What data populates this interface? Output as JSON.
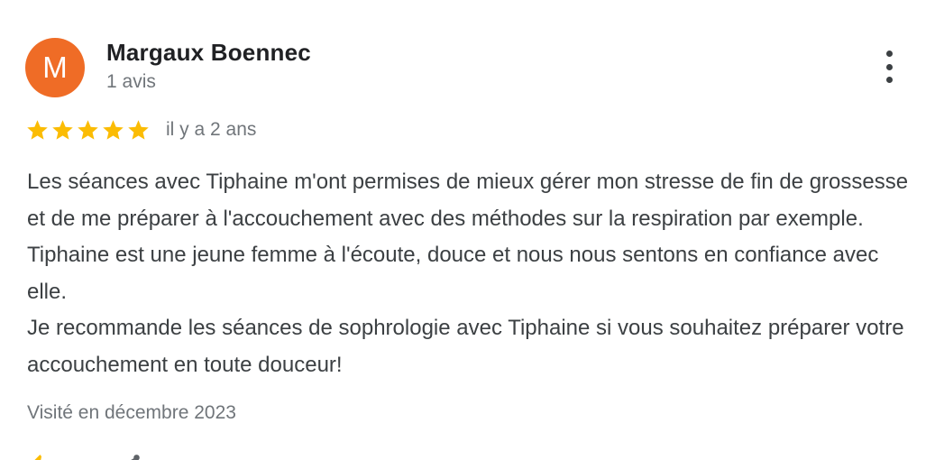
{
  "author": {
    "initial": "M",
    "name": "Margaux Boennec",
    "review_count": "1 avis",
    "avatar_color": "#ef6c26"
  },
  "more_menu_icon": "more-vertical-icon",
  "rating": {
    "stars": 5,
    "max": 5,
    "star_color": "#fbbc04",
    "date": "il y a 2 ans"
  },
  "review": {
    "paragraph_1": "Les séances avec Tiphaine m'ont permises de mieux gérer mon stresse de fin de grossesse et de me préparer à l'accouchement avec des méthodes sur la respiration par exemple. Tiphaine est une jeune femme à l'écoute, douce et nous nous sentons en confiance avec elle.",
    "paragraph_2": "Je recommande les séances de sophrologie avec Tiphaine si vous souhaitez préparer votre accouchement en toute douceur!"
  },
  "visit": {
    "label": "Visité en décembre 2023"
  },
  "actions": {
    "like_icon": "thumbs-up-icon",
    "share_icon": "share-icon"
  }
}
